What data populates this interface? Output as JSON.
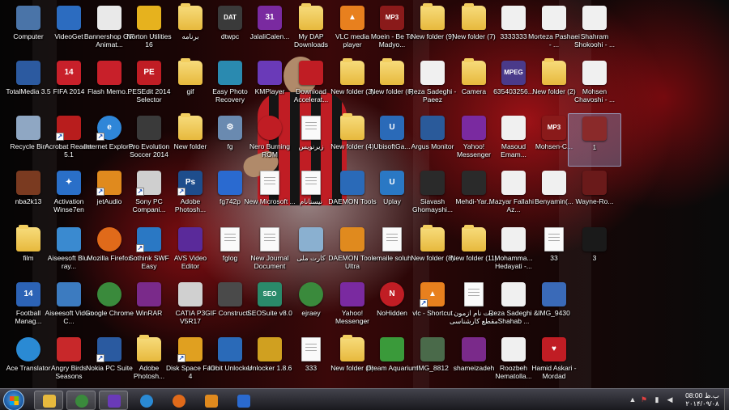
{
  "colors": {
    "accent_red": "#c01d24",
    "folder": "#e7b93d",
    "taskbar": "#25252b",
    "label_text": "#ffffff"
  },
  "icons": [
    {
      "label": "Computer",
      "icon": "computer-icon",
      "type": "app",
      "color": "#4a74a8",
      "glyph": ""
    },
    {
      "label": "TotalMedia 3.5",
      "icon": "totalmedia-icon",
      "type": "app",
      "color": "#2c5aa0",
      "glyph": ""
    },
    {
      "label": "Recycle Bin",
      "icon": "recycle-bin-icon",
      "type": "app",
      "color": "#8fa7c3",
      "glyph": ""
    },
    {
      "label": "nba2k13",
      "icon": "nba2k13-icon",
      "type": "app",
      "color": "#7a3a20",
      "glyph": ""
    },
    {
      "label": "film",
      "icon": "folder-icon",
      "type": "folder",
      "color": "#e7b93d",
      "glyph": ""
    },
    {
      "label": "Football Manag...",
      "icon": "football-manager-icon",
      "type": "app",
      "color": "#2c63b6",
      "glyph": "14"
    },
    {
      "label": "Ace Translator",
      "icon": "ace-translator-icon",
      "type": "app",
      "color": "#2a8ad4",
      "glyph": ""
    },
    {
      "label": "VideoGet",
      "icon": "videoget-icon",
      "type": "app",
      "color": "#2c6cc0",
      "glyph": ""
    },
    {
      "label": "FIFA 2014",
      "icon": "fifa-icon",
      "type": "app",
      "color": "#c8202a",
      "glyph": "14"
    },
    {
      "label": "Acrobat Reader 5.1",
      "icon": "acrobat-icon",
      "type": "shortcut",
      "color": "#b81d1d",
      "glyph": ""
    },
    {
      "label": "Activation Winse7en",
      "icon": "activation-icon",
      "type": "app",
      "color": "#2a6fc8",
      "glyph": "✦"
    },
    {
      "label": "Aiseesoft Blu-ray...",
      "icon": "aiseesoft-bluray-icon",
      "type": "app",
      "color": "#3a8ad0",
      "glyph": ""
    },
    {
      "label": "Aiseesoft Video C...",
      "icon": "aiseesoft-video-icon",
      "type": "app",
      "color": "#3c7bc0",
      "glyph": ""
    },
    {
      "label": "Angry Birds Seasons",
      "icon": "angry-birds-icon",
      "type": "app",
      "color": "#c8282a",
      "glyph": ""
    },
    {
      "label": "Bannershop GIF Animat...",
      "icon": "bannershop-icon",
      "type": "app",
      "color": "#e9e9e9",
      "glyph": ""
    },
    {
      "label": "Flash Memo...",
      "icon": "flash-memory-icon",
      "type": "app",
      "color": "#c8202a",
      "glyph": ""
    },
    {
      "label": "Internet Explorer",
      "icon": "internet-explorer-icon",
      "type": "shortcut",
      "color": "#2f86d8",
      "glyph": "e"
    },
    {
      "label": "jetAudio",
      "icon": "jetaudio-icon",
      "type": "shortcut",
      "color": "#e08a1e",
      "glyph": ""
    },
    {
      "label": "Mozilla Firefox",
      "icon": "firefox-icon",
      "type": "app",
      "color": "#e06a1a",
      "glyph": ""
    },
    {
      "label": "Google Chrome",
      "icon": "chrome-icon",
      "type": "app",
      "color": "#3a8a3c",
      "glyph": ""
    },
    {
      "label": "Nokia PC Suite",
      "icon": "nokia-icon",
      "type": "shortcut",
      "color": "#2a5aa0",
      "glyph": ""
    },
    {
      "label": "Norton Utilities 16",
      "icon": "norton-icon",
      "type": "app",
      "color": "#e6b21e",
      "glyph": ""
    },
    {
      "label": "PESEdit 2014 Selector",
      "icon": "pesedit-icon",
      "type": "app",
      "color": "#c01d24",
      "glyph": "PE"
    },
    {
      "label": "Pro Evolution Soccer 2014",
      "icon": "pes-icon",
      "type": "app",
      "color": "#3a3a3a",
      "glyph": ""
    },
    {
      "label": "Sony PC Compani...",
      "icon": "sony-icon",
      "type": "shortcut",
      "color": "#cfcfcf",
      "glyph": ""
    },
    {
      "label": "Sothink SWF Easy",
      "icon": "sothink-icon",
      "type": "shortcut",
      "color": "#2a78c4",
      "glyph": ""
    },
    {
      "label": "WinRAR",
      "icon": "winrar-icon",
      "type": "app",
      "color": "#7a2a8a",
      "glyph": ""
    },
    {
      "label": "Adobe Photosh...",
      "icon": "folder-icon",
      "type": "folder",
      "color": "#e7b93d",
      "glyph": ""
    },
    {
      "label": "برنامه",
      "icon": "folder-icon",
      "type": "folder",
      "color": "#e7b93d",
      "glyph": ""
    },
    {
      "label": "gif",
      "icon": "folder-icon",
      "type": "folder",
      "color": "#e7b93d",
      "glyph": ""
    },
    {
      "label": "New folder",
      "icon": "folder-icon",
      "type": "folder",
      "color": "#e7b93d",
      "glyph": ""
    },
    {
      "label": "Adobe Photosh...",
      "icon": "photoshop-icon",
      "type": "shortcut",
      "color": "#1e4d8c",
      "glyph": "Ps"
    },
    {
      "label": "AVS Video Editor",
      "icon": "avs-icon",
      "type": "app",
      "color": "#5a2a9a",
      "glyph": ""
    },
    {
      "label": "CATIA P3 V5R17",
      "icon": "catia-icon",
      "type": "app",
      "color": "#d0d0d0",
      "glyph": ""
    },
    {
      "label": "Disk Space Fan 4",
      "icon": "disk-space-fan-icon",
      "type": "shortcut",
      "color": "#e0a020",
      "glyph": ""
    },
    {
      "label": "dtwpc",
      "icon": "dat-file-icon",
      "type": "app",
      "color": "#3a3a3a",
      "glyph": "DAT"
    },
    {
      "label": "Easy Photo Recovery",
      "icon": "easy-photo-icon",
      "type": "app",
      "color": "#2a8ab0",
      "glyph": ""
    },
    {
      "label": "fg",
      "icon": "settings-file-icon",
      "type": "app",
      "color": "#6a8ab0",
      "glyph": "⚙"
    },
    {
      "label": "fg742p",
      "icon": "fg742p-icon",
      "type": "app",
      "color": "#2a6ad0",
      "glyph": ""
    },
    {
      "label": "fglog",
      "icon": "document-icon",
      "type": "doc",
      "color": "#fafafa",
      "glyph": ""
    },
    {
      "label": "GIF Constructi...",
      "icon": "gif-constructor-icon",
      "type": "app",
      "color": "#4a4a4a",
      "glyph": ""
    },
    {
      "label": "IObit Unlocker",
      "icon": "iobit-icon",
      "type": "app",
      "color": "#2a6ab8",
      "glyph": ""
    },
    {
      "label": "JalaliCalen...",
      "icon": "jalali-calendar-icon",
      "type": "app",
      "color": "#7a2aa0",
      "glyph": "31"
    },
    {
      "label": "KMPlayer",
      "icon": "kmplayer-icon",
      "type": "app",
      "color": "#6a3ab8",
      "glyph": ""
    },
    {
      "label": "Nero Burning ROM",
      "icon": "nero-icon",
      "type": "app",
      "color": "#c01d24",
      "glyph": ""
    },
    {
      "label": "New Microsoft ...",
      "icon": "word-doc-icon",
      "type": "doc",
      "color": "#fafafa",
      "glyph": ""
    },
    {
      "label": "New Journal Document",
      "icon": "journal-icon",
      "type": "doc",
      "color": "#fafafa",
      "glyph": ""
    },
    {
      "label": "SEOSuite v8.0",
      "icon": "seosuite-icon",
      "type": "app",
      "color": "#2a8a6a",
      "glyph": "SEO"
    },
    {
      "label": "Unlocker 1.8.6",
      "icon": "unlocker-icon",
      "type": "app",
      "color": "#d0a020",
      "glyph": ""
    },
    {
      "label": "My DAP Downloads",
      "icon": "folder-icon",
      "type": "folder",
      "color": "#e7b93d",
      "glyph": ""
    },
    {
      "label": "Download Accelerat...",
      "icon": "download-accelerator-icon",
      "type": "app",
      "color": "#c01d24",
      "glyph": ""
    },
    {
      "label": "زیرنویس",
      "icon": "text-file-icon",
      "type": "doc",
      "color": "#fafafa",
      "glyph": ""
    },
    {
      "label": "نیستانام",
      "icon": "text-file-icon",
      "type": "doc",
      "color": "#fafafa",
      "glyph": ""
    },
    {
      "label": "کارت ملی",
      "icon": "id-card-icon",
      "type": "app",
      "color": "#8ab0d0",
      "glyph": ""
    },
    {
      "label": "ejraey",
      "icon": "chrome-icon",
      "type": "app",
      "color": "#3a8a3c",
      "glyph": ""
    },
    {
      "label": "333",
      "icon": "text-file-icon",
      "type": "doc",
      "color": "#fafafa",
      "glyph": ""
    },
    {
      "label": "VLC media player",
      "icon": "vlc-icon",
      "type": "app",
      "color": "#e8801e",
      "glyph": "▲"
    },
    {
      "label": "New folder (3)",
      "icon": "folder-icon",
      "type": "folder",
      "color": "#e7b93d",
      "glyph": ""
    },
    {
      "label": "New folder (4)",
      "icon": "folder-icon",
      "type": "folder",
      "color": "#e7b93d",
      "glyph": ""
    },
    {
      "label": "DAEMON Tools",
      "icon": "daemon-tools-icon",
      "type": "app",
      "color": "#2a6ab8",
      "glyph": ""
    },
    {
      "label": "DAEMON Tools Ultra",
      "icon": "daemon-ultra-icon",
      "type": "app",
      "color": "#e08a1e",
      "glyph": ""
    },
    {
      "label": "Yahoo! Messenger",
      "icon": "yahoo-icon",
      "type": "app",
      "color": "#7a2aa0",
      "glyph": ""
    },
    {
      "label": "New folder (5)",
      "icon": "folder-icon",
      "type": "folder",
      "color": "#e7b93d",
      "glyph": ""
    },
    {
      "label": "Moein - Be To Madyo...",
      "icon": "mp3-icon",
      "type": "app",
      "color": "#8a1a1a",
      "glyph": "MP3"
    },
    {
      "label": "New folder (6)",
      "icon": "folder-icon",
      "type": "folder",
      "color": "#e7b93d",
      "glyph": ""
    },
    {
      "label": "UbisoftGa...",
      "icon": "ubisoft-icon",
      "type": "app",
      "color": "#2a6ab8",
      "glyph": "U"
    },
    {
      "label": "Uplay",
      "icon": "uplay-icon",
      "type": "app",
      "color": "#2a78c4",
      "glyph": "U"
    },
    {
      "label": "emaile soluh",
      "icon": "text-file-icon",
      "type": "doc",
      "color": "#fafafa",
      "glyph": ""
    },
    {
      "label": "NoHidden",
      "icon": "nohidden-icon",
      "type": "app",
      "color": "#c01d24",
      "glyph": "N"
    },
    {
      "label": "Dream Aquarium",
      "icon": "dream-aquarium-icon",
      "type": "app",
      "color": "#3a9a3a",
      "glyph": ""
    },
    {
      "label": "New folder (9)",
      "icon": "folder-icon",
      "type": "folder",
      "color": "#e7b93d",
      "glyph": ""
    },
    {
      "label": "Reza Sadeghi - Paeez",
      "icon": "audio-file-icon",
      "type": "app",
      "color": "#f0f0f0",
      "glyph": ""
    },
    {
      "label": "Argus Monitor",
      "icon": "argus-icon",
      "type": "app",
      "color": "#2a5a9a",
      "glyph": ""
    },
    {
      "label": "Siavash Ghomayshi...",
      "icon": "video-file-icon",
      "type": "app",
      "color": "#2a2a2a",
      "glyph": ""
    },
    {
      "label": "New folder (8)",
      "icon": "folder-icon",
      "type": "folder",
      "color": "#e7b93d",
      "glyph": ""
    },
    {
      "label": "vlc - Shortcut",
      "icon": "vlc-icon",
      "type": "shortcut",
      "color": "#e8801e",
      "glyph": "▲"
    },
    {
      "label": "IMG_8812",
      "icon": "image-file-icon",
      "type": "app",
      "color": "#4a6a4a",
      "glyph": ""
    },
    {
      "label": "New folder (7)",
      "icon": "folder-icon",
      "type": "folder",
      "color": "#e7b93d",
      "glyph": ""
    },
    {
      "label": "Camera",
      "icon": "folder-icon",
      "type": "folder",
      "color": "#e7b93d",
      "glyph": ""
    },
    {
      "label": "Yahoo! Messenger",
      "icon": "yahoo-icon",
      "type": "app",
      "color": "#7a2aa0",
      "glyph": ""
    },
    {
      "label": "Mehdi-Yar...",
      "icon": "video-file-icon",
      "type": "app",
      "color": "#2a2a2a",
      "glyph": ""
    },
    {
      "label": "New folder (11)",
      "icon": "folder-icon",
      "type": "folder",
      "color": "#e7b93d",
      "glyph": ""
    },
    {
      "label": "بیت نام ازمون مقطع کارشناسی",
      "icon": "word-doc-icon",
      "type": "doc",
      "color": "#fafafa",
      "glyph": ""
    },
    {
      "label": "shameizadeh",
      "icon": "rar-file-icon",
      "type": "app",
      "color": "#7a2a8a",
      "glyph": ""
    },
    {
      "label": "3333333",
      "icon": "image-file-icon",
      "type": "app",
      "color": "#f0f0f0",
      "glyph": ""
    },
    {
      "label": "635403256...",
      "icon": "mpeg-file-icon",
      "type": "app",
      "color": "#4a3a8a",
      "glyph": "MPEG"
    },
    {
      "label": "Masoud Emam...",
      "icon": "audio-file-icon",
      "type": "app",
      "color": "#f0f0f0",
      "glyph": ""
    },
    {
      "label": "Mazyar Fallahi - Az...",
      "icon": "audio-file-icon",
      "type": "app",
      "color": "#f0f0f0",
      "glyph": ""
    },
    {
      "label": "Mohamma... Hedayati -...",
      "icon": "audio-file-icon",
      "type": "app",
      "color": "#f0f0f0",
      "glyph": ""
    },
    {
      "label": "Reza Sadeghi & Shahab ...",
      "icon": "audio-file-icon",
      "type": "app",
      "color": "#f0f0f0",
      "glyph": ""
    },
    {
      "label": "Roozbeh Nematolla...",
      "icon": "audio-file-icon",
      "type": "app",
      "color": "#f0f0f0",
      "glyph": ""
    },
    {
      "label": "Morteza Pashaei - ...",
      "icon": "audio-file-icon",
      "type": "app",
      "color": "#f0f0f0",
      "glyph": ""
    },
    {
      "label": "New folder (2)",
      "icon": "folder-icon",
      "type": "folder",
      "color": "#e7b93d",
      "glyph": ""
    },
    {
      "label": "Mohsen-C...",
      "icon": "mp3-icon",
      "type": "app",
      "color": "#8a1a1a",
      "glyph": "MP3"
    },
    {
      "label": "Benyamin(...",
      "icon": "audio-file-icon",
      "type": "app",
      "color": "#f0f0f0",
      "glyph": ""
    },
    {
      "label": "33",
      "icon": "text-file-icon",
      "type": "doc",
      "color": "#fafafa",
      "glyph": ""
    },
    {
      "label": "IMG_9430",
      "icon": "image-file-icon",
      "type": "app",
      "color": "#3a6ab8",
      "glyph": ""
    },
    {
      "label": "Hamid Askari - Mordad",
      "icon": "audio-file-icon",
      "type": "app",
      "color": "#c01d24",
      "glyph": "♥"
    },
    {
      "label": "Shahram Shokoohi - ...",
      "icon": "audio-file-icon",
      "type": "app",
      "color": "#f0f0f0",
      "glyph": ""
    },
    {
      "label": "Mohsen Chavoshi - ...",
      "icon": "audio-file-icon",
      "type": "app",
      "color": "#f0f0f0",
      "glyph": ""
    },
    {
      "label": "1",
      "icon": "image-file-icon",
      "type": "app",
      "color": "#8a2a2a",
      "glyph": "",
      "selected": true
    },
    {
      "label": "Wayne-Ro...",
      "icon": "image-file-icon",
      "type": "app",
      "color": "#6a1a1a",
      "glyph": ""
    },
    {
      "label": "3",
      "icon": "blank-file-icon",
      "type": "app",
      "color": "#1a1a1a",
      "glyph": ""
    }
  ],
  "taskbar": {
    "pinned": [
      {
        "name": "explorer-icon",
        "color": "#e7b93d"
      },
      {
        "name": "chrome-icon",
        "color": "#3a8a3c"
      },
      {
        "name": "kmplayer-icon",
        "color": "#6a3ab8"
      },
      {
        "name": "network-icon",
        "color": "#2a8ad4"
      },
      {
        "name": "firefox-icon",
        "color": "#e06a1a"
      },
      {
        "name": "media-player-icon",
        "color": "#e08a1e"
      },
      {
        "name": "fg742p-icon",
        "color": "#2a6ad0"
      }
    ],
    "clock": {
      "time": "ب.ظ 08:00",
      "date": "۲۰۱۴/۰۹/۰۸"
    }
  }
}
